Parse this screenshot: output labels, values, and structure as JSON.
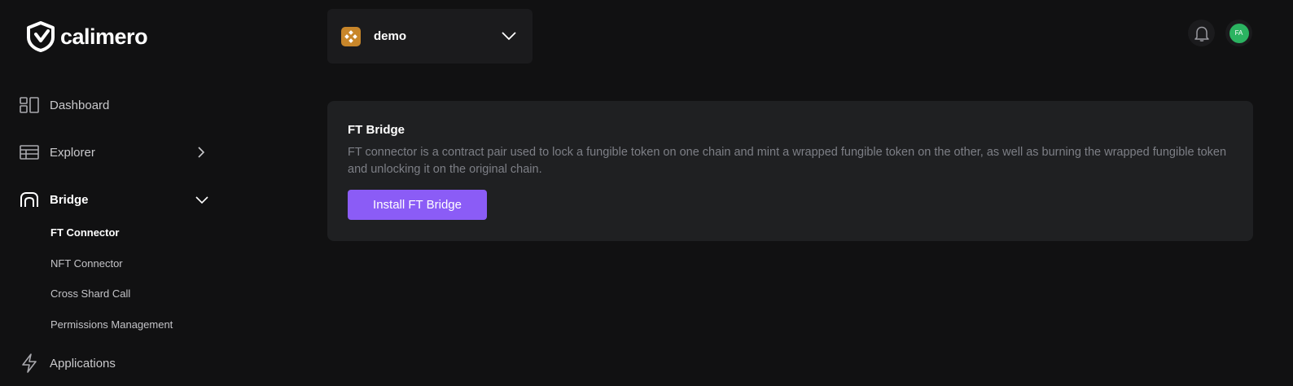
{
  "brand": {
    "name": "calimero"
  },
  "sidebar": {
    "items": [
      {
        "label": "Dashboard",
        "icon": "dashboard-icon"
      },
      {
        "label": "Explorer",
        "icon": "table-icon"
      },
      {
        "label": "Bridge",
        "icon": "bridge-icon"
      },
      {
        "label": "Applications",
        "icon": "lightning-icon"
      }
    ],
    "bridge_subitems": [
      {
        "label": "FT Connector",
        "active": true
      },
      {
        "label": "NFT Connector"
      },
      {
        "label": "Cross Shard Call"
      },
      {
        "label": "Permissions Management"
      }
    ]
  },
  "context_selector": {
    "value": "demo",
    "icon": "shard-logo-icon"
  },
  "header": {
    "avatar_initials": "FA",
    "notification_icon": "bell-icon"
  },
  "card": {
    "title": "FT Bridge",
    "description": "FT connector is a contract pair used to lock a fungible token on one chain and mint a wrapped fungible token on the other, as well as burning the wrapped fungible token and unlocking it on the original chain.",
    "button_label": "Install FT Bridge"
  },
  "colors": {
    "background": "#111112",
    "accent": "#8b5cf6",
    "avatar": "#2bb361",
    "context_logo": "#c8862a"
  }
}
